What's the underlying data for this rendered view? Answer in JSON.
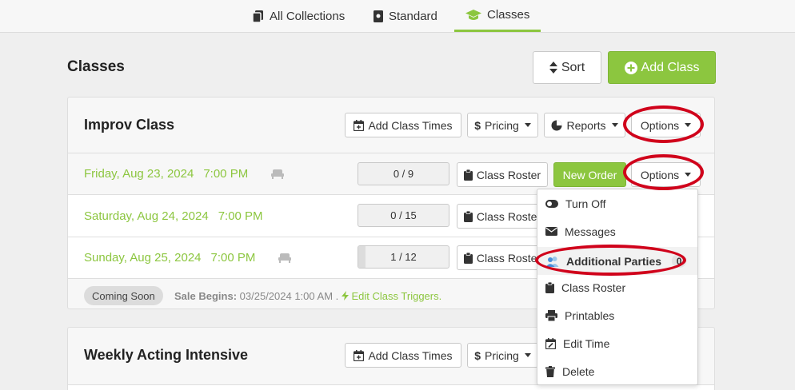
{
  "topnav": {
    "tabs": [
      {
        "label": "All Collections",
        "icon": "copy-icon"
      },
      {
        "label": "Standard",
        "icon": "document-icon"
      },
      {
        "label": "Classes",
        "icon": "graduation-cap-icon",
        "active": true
      }
    ]
  },
  "page": {
    "title": "Classes",
    "sort_label": "Sort",
    "add_class_label": "Add Class"
  },
  "card1": {
    "title": "Improv Class",
    "buttons": {
      "add_times": "Add Class Times",
      "pricing": "Pricing",
      "reports": "Reports",
      "options": "Options"
    },
    "rows": [
      {
        "date": "Friday, Aug 23, 2024",
        "time": "7:00 PM",
        "count": "0 / 9",
        "filled": 0.0,
        "roster": "Class Roster",
        "new_order": "New Order",
        "options": "Options"
      },
      {
        "date": "Saturday, Aug 24, 2024",
        "time": "7:00 PM",
        "count": "0 / 15",
        "filled": 0.0,
        "roster": "Class Roster"
      },
      {
        "date": "Sunday, Aug 25, 2024",
        "time": "7:00 PM",
        "count": "1 / 12",
        "filled": 0.083,
        "roster": "Class Roster"
      }
    ],
    "footer": {
      "status": "Coming Soon",
      "sale_label": "Sale Begins:",
      "sale_value": "03/25/2024 1:00 AM .",
      "triggers": "Edit Class Triggers."
    }
  },
  "card2": {
    "title": "Weekly Acting Intensive",
    "buttons": {
      "add_times": "Add Class Times",
      "pricing": "Pricing"
    }
  },
  "dropdown": {
    "items": [
      {
        "label": "Turn Off",
        "icon": "toggle-icon"
      },
      {
        "label": "Messages",
        "icon": "envelope-icon"
      },
      {
        "label": "Additional Parties",
        "icon": "users-icon",
        "badge": "0"
      },
      {
        "label": "Class Roster",
        "icon": "clipboard-icon"
      },
      {
        "label": "Printables",
        "icon": "printer-icon"
      },
      {
        "label": "Edit Time",
        "icon": "calendar-edit-icon"
      },
      {
        "label": "Delete",
        "icon": "trash-icon"
      }
    ]
  },
  "colors": {
    "accent": "#8cc63f",
    "annotation": "#d0021b",
    "background": "#efefef"
  }
}
